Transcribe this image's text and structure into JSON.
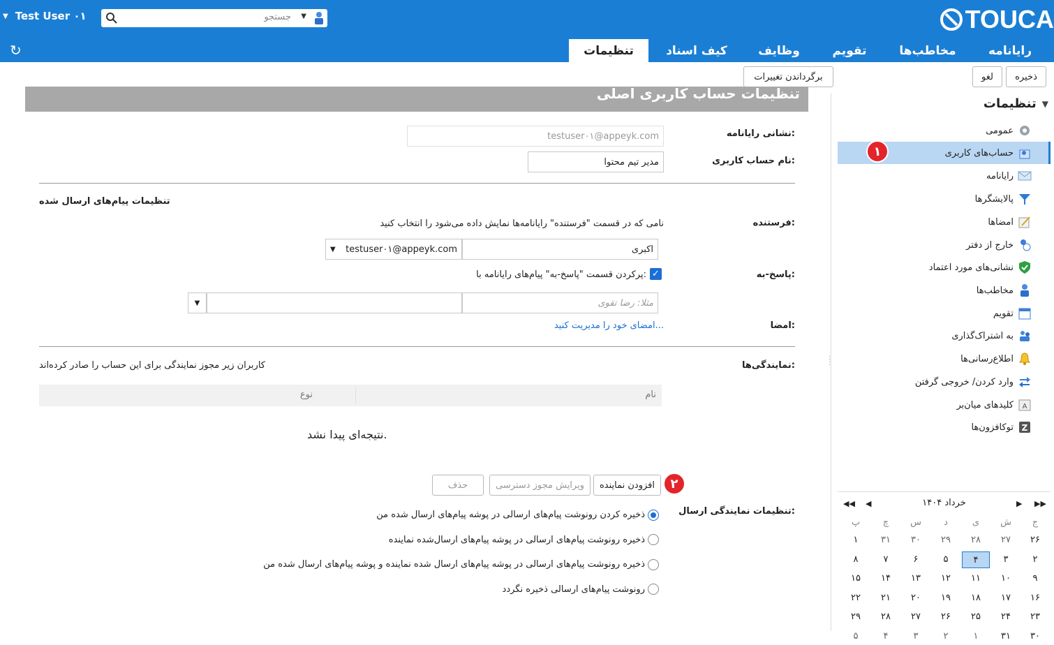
{
  "brand": {
    "name": "TOUCA"
  },
  "user": {
    "name": "Test User ۰۱"
  },
  "search": {
    "placeholder": "جستجو"
  },
  "tabs": [
    {
      "label": "رایانامه"
    },
    {
      "label": "مخاطب‌ها"
    },
    {
      "label": "تقویم"
    },
    {
      "label": "وظایف"
    },
    {
      "label": "کیف اسناد"
    },
    {
      "label": "تنظیمات"
    }
  ],
  "toolbar": {
    "save": "ذخیره",
    "cancel": "لغو",
    "revert": "برگرداندن تغییرات"
  },
  "sidebar": {
    "title": "تنظیمات",
    "items": [
      {
        "label": "عمومی",
        "icon": "gear-icon"
      },
      {
        "label": "حساب‌های کاربری",
        "icon": "account-icon"
      },
      {
        "label": "رایانامه",
        "icon": "mail-icon"
      },
      {
        "label": "پالایشگرها",
        "icon": "filter-icon"
      },
      {
        "label": "امضاها",
        "icon": "signature-icon"
      },
      {
        "label": "خارج از دفتر",
        "icon": "out-of-office-icon"
      },
      {
        "label": "نشانی‌های مورد اعتماد",
        "icon": "shield-icon"
      },
      {
        "label": "مخاطب‌ها",
        "icon": "contact-icon"
      },
      {
        "label": "تقویم",
        "icon": "calendar-icon"
      },
      {
        "label": "به اشتراک‌گذاری",
        "icon": "share-icon"
      },
      {
        "label": "اطلاع‌رسانی‌ها",
        "icon": "bell-icon"
      },
      {
        "label": "وارد کردن/ خروجی گرفتن",
        "icon": "import-export-icon"
      },
      {
        "label": "کلیدهای میان‌بر",
        "icon": "keyboard-icon"
      },
      {
        "label": "توکافزون‌ها",
        "icon": "zimlet-icon"
      }
    ],
    "active_index": 1
  },
  "badges": {
    "one": "۱",
    "two": "۲"
  },
  "calendar": {
    "title": "۱۴۰۴ خرداد",
    "weekdays": [
      "ش",
      "ی",
      "د",
      "س",
      "چ",
      "پ",
      "ج"
    ],
    "rows": [
      [
        "۲۷",
        "۲۸",
        "۲۹",
        "۳۰",
        "۳۱",
        "۱",
        "۲۶"
      ],
      [
        "۳",
        "۴",
        "۵",
        "۶",
        "۷",
        "۸",
        "۲"
      ],
      [
        "۱۰",
        "۱۱",
        "۱۲",
        "۱۳",
        "۱۴",
        "۱۵",
        "۹"
      ],
      [
        "۱۷",
        "۱۸",
        "۱۹",
        "۲۰",
        "۲۱",
        "۲۲",
        "۱۶"
      ],
      [
        "۲۴",
        "۲۵",
        "۲۶",
        "۲۷",
        "۲۸",
        "۲۹",
        "۲۳"
      ],
      [
        "۳۱",
        "۱",
        "۲",
        "۳",
        "۴",
        "۵",
        "۳۰"
      ]
    ],
    "today": "۴"
  },
  "form": {
    "banner": "تنظیمات حساب کاربری اصلی",
    "email_label": "نشانی رایانامه:",
    "email_value": "testuser۰۱@appeyk.com",
    "account_label": "نام حساب کاربری:",
    "account_value": "مدیر تیم محتوا",
    "sent_section": "تنظیمات پیام‌های ارسال شده",
    "sender_label": "فرستنده:",
    "sender_hint": "نامی که در قسمت \"فرستنده\" رایانامه‌ها نمایش داده می‌شود را انتخاب کنید",
    "sender_name": "اکبری",
    "sender_address": "testuser۰۱@appeyk.com",
    "replyto_label": "پاسخ-به:",
    "replyto_check": "پرکردن قسمت \"پاسخ-به\" پیام‌های رایانامه با:",
    "replyto_placeholder": "مثلا: رضا تقوی",
    "signature_label": "امضا:",
    "signature_link": "امضای خود را مدیریت کنید...",
    "delegates_label": "نمایندگی‌ها:",
    "delegates_hint": "کاربران زیر مجوز نمایندگی برای این حساب را صادر کرده‌اند",
    "col_name": "نام",
    "col_type": "نوع",
    "no_result": "نتیجه‌ای پیدا نشد.",
    "add_delegate": "افزودن نماینده",
    "edit_permission": "ویرایش مجوز دسترسی",
    "remove": "حذف",
    "delegate_send_label": "تنظیمات نمایندگی ارسال:",
    "options": [
      "ذخیره کردن رونوشت پیام‌های ارسالی در پوشه پیام‌های ارسال شده من",
      "ذخیره رونوشت پیام‌های ارسالی در پوشه پیام‌های ارسال‌شده نماینده",
      "ذخیره رونوشت پیام‌های ارسالی در پوشه پیام‌های ارسال شده نماینده و پوشه پیام‌های ارسال شده من",
      "رونوشت پیام‌های ارسالی ذخیره نگردد"
    ],
    "selected_option": 0
  }
}
